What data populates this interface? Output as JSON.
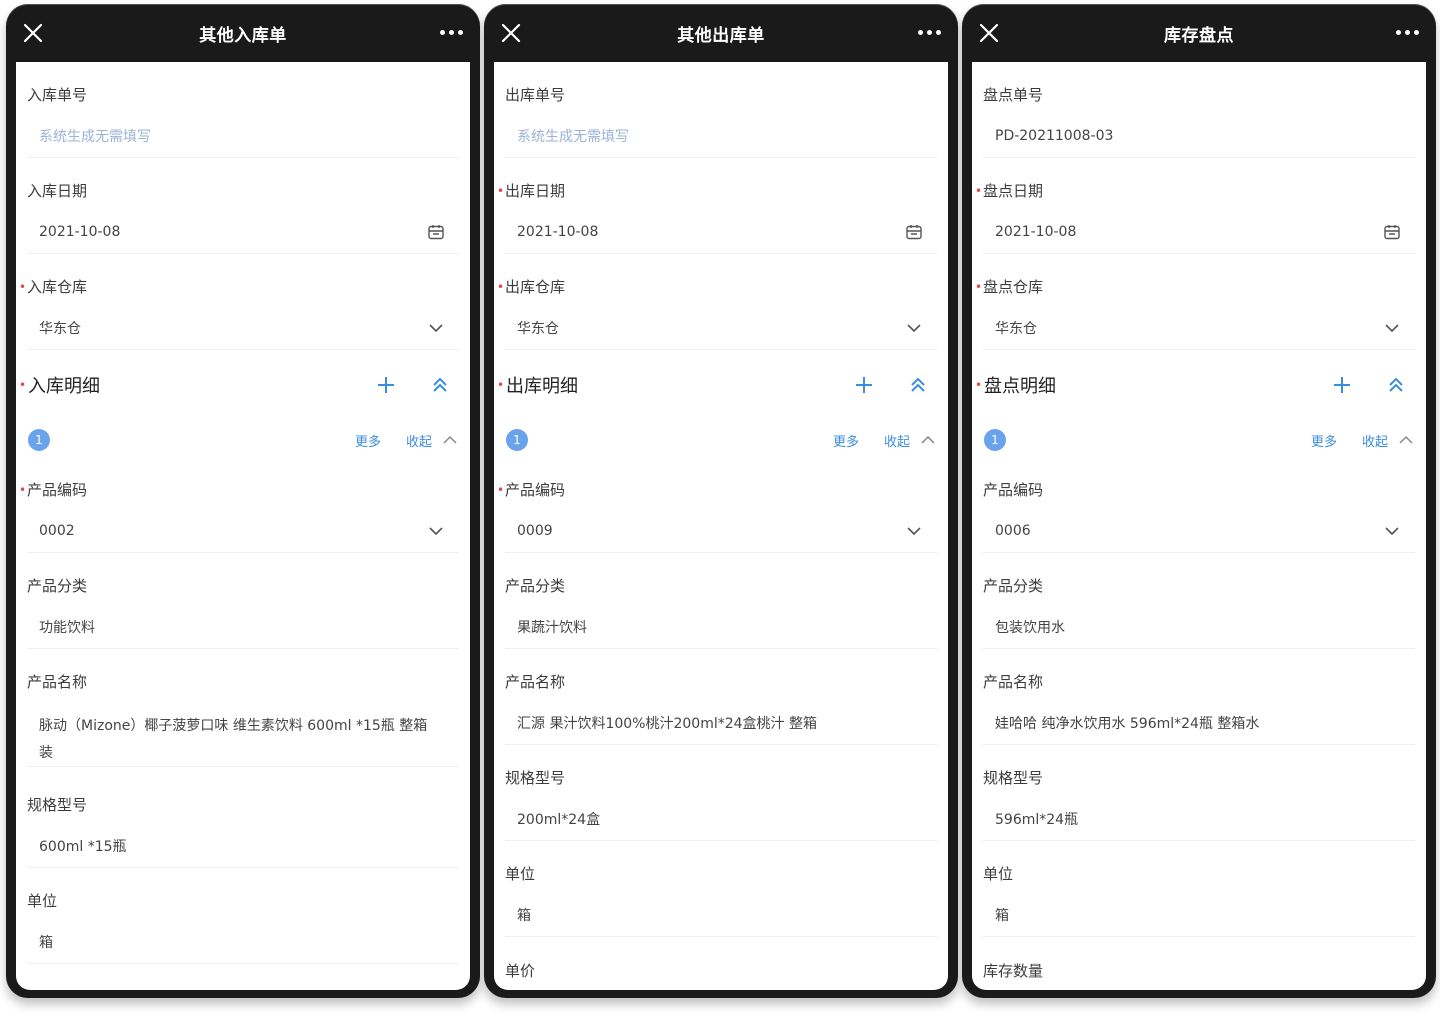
{
  "phones": [
    {
      "title": "其他入库单",
      "order_no": {
        "label": "入库单号",
        "placeholder": "系统生成无需填写"
      },
      "date": {
        "label": "入库日期",
        "value": "2021-10-08"
      },
      "warehouse": {
        "label": "入库仓库",
        "value": "华东仓"
      },
      "detail_title": "入库明细",
      "item_index": "1",
      "more": "更多",
      "collapse": "收起",
      "product_code": {
        "label": "产品编码",
        "value": "0002"
      },
      "category": {
        "label": "产品分类",
        "value": "功能饮料"
      },
      "name": {
        "label": "产品名称",
        "value": "脉动（Mizone）椰子菠萝口味 维生素饮料 600ml *15瓶 整箱装"
      },
      "spec": {
        "label": "规格型号",
        "value": "600ml *15瓶"
      },
      "unit": {
        "label": "单位",
        "value": "箱"
      }
    },
    {
      "title": "其他出库单",
      "order_no": {
        "label": "出库单号",
        "placeholder": "系统生成无需填写"
      },
      "date": {
        "label": "出库日期",
        "value": "2021-10-08"
      },
      "warehouse": {
        "label": "出库仓库",
        "value": "华东仓"
      },
      "detail_title": "出库明细",
      "item_index": "1",
      "more": "更多",
      "collapse": "收起",
      "product_code": {
        "label": "产品编码",
        "value": "0009"
      },
      "category": {
        "label": "产品分类",
        "value": "果蔬汁饮料"
      },
      "name": {
        "label": "产品名称",
        "value": "汇源 果汁饮料100%桃汁200ml*24盒桃汁 整箱"
      },
      "spec": {
        "label": "规格型号",
        "value": "200ml*24盒"
      },
      "unit": {
        "label": "单位",
        "value": "箱"
      },
      "extra_label": "单价"
    },
    {
      "title": "库存盘点",
      "order_no": {
        "label": "盘点单号",
        "value": "PD-20211008-03"
      },
      "date": {
        "label": "盘点日期",
        "value": "2021-10-08"
      },
      "warehouse": {
        "label": "盘点仓库",
        "value": "华东仓"
      },
      "detail_title": "盘点明细",
      "item_index": "1",
      "more": "更多",
      "collapse": "收起",
      "product_code": {
        "label": "产品编码",
        "value": "0006"
      },
      "category": {
        "label": "产品分类",
        "value": "包装饮用水"
      },
      "name": {
        "label": "产品名称",
        "value": "娃哈哈 纯净水饮用水 596ml*24瓶 整箱水"
      },
      "spec": {
        "label": "规格型号",
        "value": "596ml*24瓶"
      },
      "unit": {
        "label": "单位",
        "value": "箱"
      },
      "extra_label": "库存数量"
    }
  ],
  "icons": {
    "close": "close-icon",
    "more": "more-dots-icon",
    "calendar": "calendar-icon",
    "dropdown": "chevron-down-icon",
    "add": "plus-icon",
    "collapse_section": "double-chevron-up-icon",
    "collapse_item": "chevron-up-icon"
  },
  "colors": {
    "accent": "#3b8de0",
    "badge": "#6aa3ec",
    "required": "#e04a4a",
    "placeholder": "#9bb3d6",
    "navbar": "#1a1a1a"
  }
}
